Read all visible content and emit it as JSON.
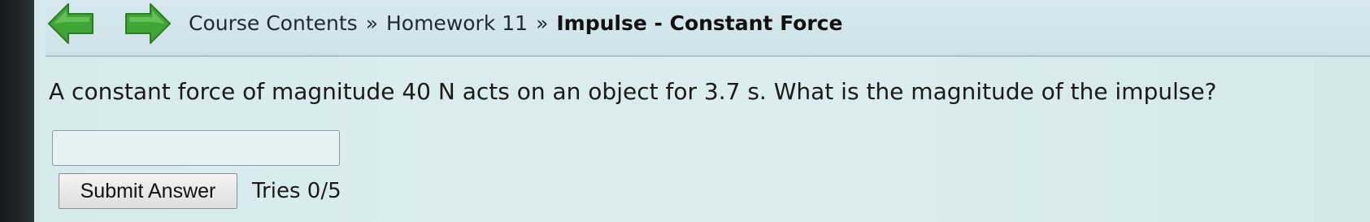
{
  "nav": {
    "back_icon": "green-left-arrow-icon",
    "forward_icon": "green-right-arrow-icon",
    "arrow_color": "#3fa535"
  },
  "breadcrumb": {
    "items": [
      "Course Contents",
      "Homework 11"
    ],
    "separator": "»",
    "current": "Impulse - Constant Force"
  },
  "problem": {
    "question": "A constant force of magnitude 40 N acts on an object for 3.7 s. What is the magnitude of the impulse?",
    "answer_value": ""
  },
  "actions": {
    "submit_label": "Submit Answer",
    "tries_text": "Tries 0/5"
  }
}
